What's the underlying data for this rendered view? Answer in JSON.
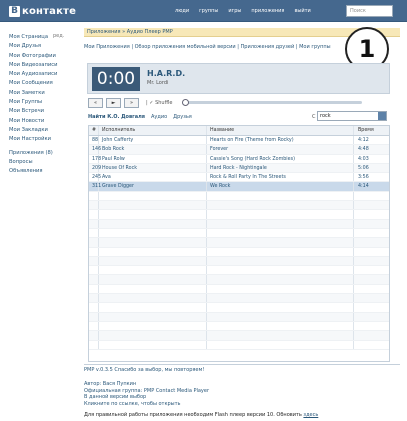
{
  "header": {
    "logo_letter": "В",
    "logo_text": "контакте",
    "nav": [
      "люди",
      "группы",
      "игры",
      "приложения",
      "выйти"
    ],
    "search_placeholder": "Поиск"
  },
  "sidebar": {
    "items": [
      "Моя Страница",
      "Мои Друзья",
      "Мои Фотографии",
      "Мои Видеозаписи",
      "Мои Аудиозаписи",
      "Мои Сообщения",
      "Мои Заметки",
      "Мои Группы",
      "Мои Встречи",
      "Мои Новости",
      "Мои Закладки",
      "Мои Настройки",
      "Приложения (8)",
      "Вопросы",
      "Объявления"
    ],
    "edit_label": "ред."
  },
  "app": {
    "title": "Приложения » Аудио Плеер PMP",
    "links": "Мои Приложения  |  Обзор приложения мобильной версии  |  Приложения друзей  |  Мои группы"
  },
  "badge": "1",
  "player": {
    "time": "0:00",
    "track_title": "H.A.R.D.",
    "track_artist": "Mr. Lordi",
    "prev_label": "«",
    "play_label": "►",
    "next_label": "»",
    "shuffle_label": "Shuffle",
    "progress": 0
  },
  "tabs": {
    "items": [
      "Найти К.О. Довгаля",
      "Аудио",
      "Друзья"
    ],
    "filter_label": "С",
    "filter_value": "rock"
  },
  "table": {
    "headers": [
      "#",
      "Исполнитель",
      "Название",
      "Время"
    ],
    "rows": [
      {
        "n": "88",
        "artist": "John Cafferty",
        "title": "Hearts on Fire (Theme from Rocky)",
        "time": "4:12"
      },
      {
        "n": "146",
        "artist": "Bob Rock",
        "title": "Forever",
        "time": "4:48"
      },
      {
        "n": "178",
        "artist": "Paul Rolw",
        "title": "Cassie's Song (Hard Rock Zombies)",
        "time": "4:03"
      },
      {
        "n": "209",
        "artist": "House Of Rock",
        "title": "Hard Rock - Nightingale",
        "time": "5:06"
      },
      {
        "n": "245",
        "artist": "Ava",
        "title": "Rock & Roll Party In The Streets",
        "time": "3:56"
      },
      {
        "n": "311",
        "artist": "Grave Digger",
        "title": "We Rock",
        "time": "4:14"
      }
    ],
    "selected_index": 5,
    "empty_rows": 17
  },
  "footer": {
    "line1": "PMP v.0.3.5 Спасибо за выбор, мы повторяем!",
    "meta": [
      "Автор: Вася Пупкин",
      "Официальная группа: PMP Contact Media Player",
      "В данной версии выбор",
      "Кликните по ссылке, чтобы открыть"
    ],
    "notice": "Для правильной работы приложения необходим Flash плеер версии 10. Обновить",
    "notice_link": "здесь"
  }
}
